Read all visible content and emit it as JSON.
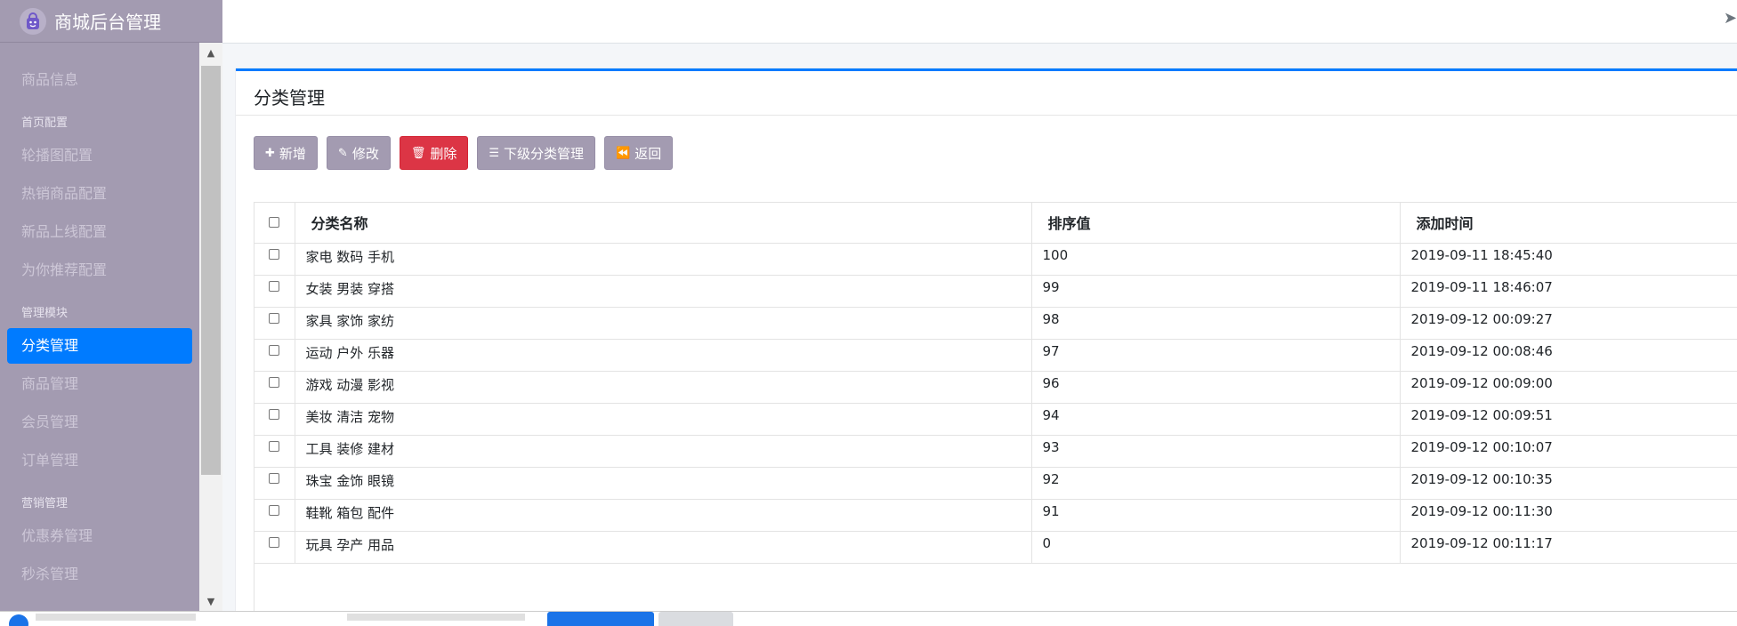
{
  "app": {
    "title": "商城后台管理"
  },
  "sidebar": {
    "sections": [
      {
        "header": "",
        "items": [
          {
            "label": "商品信息",
            "active": false
          }
        ]
      },
      {
        "header": "首页配置",
        "items": [
          {
            "label": "轮播图配置",
            "active": false
          },
          {
            "label": "热销商品配置",
            "active": false
          },
          {
            "label": "新品上线配置",
            "active": false
          },
          {
            "label": "为你推荐配置",
            "active": false
          }
        ]
      },
      {
        "header": "管理模块",
        "items": [
          {
            "label": "分类管理",
            "active": true
          },
          {
            "label": "商品管理",
            "active": false
          },
          {
            "label": "会员管理",
            "active": false
          },
          {
            "label": "订单管理",
            "active": false
          }
        ]
      },
      {
        "header": "营销管理",
        "items": [
          {
            "label": "优惠券管理",
            "active": false
          },
          {
            "label": "秒杀管理",
            "active": false
          }
        ]
      }
    ]
  },
  "page": {
    "title": "分类管理"
  },
  "toolbar": {
    "add": {
      "label": "新增",
      "icon": "plus-icon"
    },
    "edit": {
      "label": "修改",
      "icon": "edit-icon"
    },
    "delete": {
      "label": "删除",
      "icon": "trash-icon"
    },
    "sub": {
      "label": "下级分类管理",
      "icon": "list-icon"
    },
    "back": {
      "label": "返回",
      "icon": "backward-icon"
    }
  },
  "table": {
    "headers": {
      "name": "分类名称",
      "rank": "排序值",
      "time": "添加时间"
    },
    "rows": [
      {
        "name": "家电 数码 手机",
        "rank": "100",
        "time": "2019-09-11 18:45:40"
      },
      {
        "name": "女装 男装 穿搭",
        "rank": "99",
        "time": "2019-09-11 18:46:07"
      },
      {
        "name": "家具 家饰 家纺",
        "rank": "98",
        "time": "2019-09-12 00:09:27"
      },
      {
        "name": "运动 户外 乐器",
        "rank": "97",
        "time": "2019-09-12 00:08:46"
      },
      {
        "name": "游戏 动漫 影视",
        "rank": "96",
        "time": "2019-09-12 00:09:00"
      },
      {
        "name": "美妆 清洁 宠物",
        "rank": "94",
        "time": "2019-09-12 00:09:51"
      },
      {
        "name": "工具 装修 建材",
        "rank": "93",
        "time": "2019-09-12 00:10:07"
      },
      {
        "name": "珠宝 金饰 眼镜",
        "rank": "92",
        "time": "2019-09-12 00:10:35"
      },
      {
        "name": "鞋靴 箱包 配件",
        "rank": "91",
        "time": "2019-09-12 00:11:30"
      },
      {
        "name": "玩具 孕产 用品",
        "rank": "0",
        "time": "2019-09-12 00:11:17"
      }
    ]
  },
  "colors": {
    "sidebar": "#a39bb1",
    "accent": "#007bff",
    "danger": "#dc3545"
  }
}
